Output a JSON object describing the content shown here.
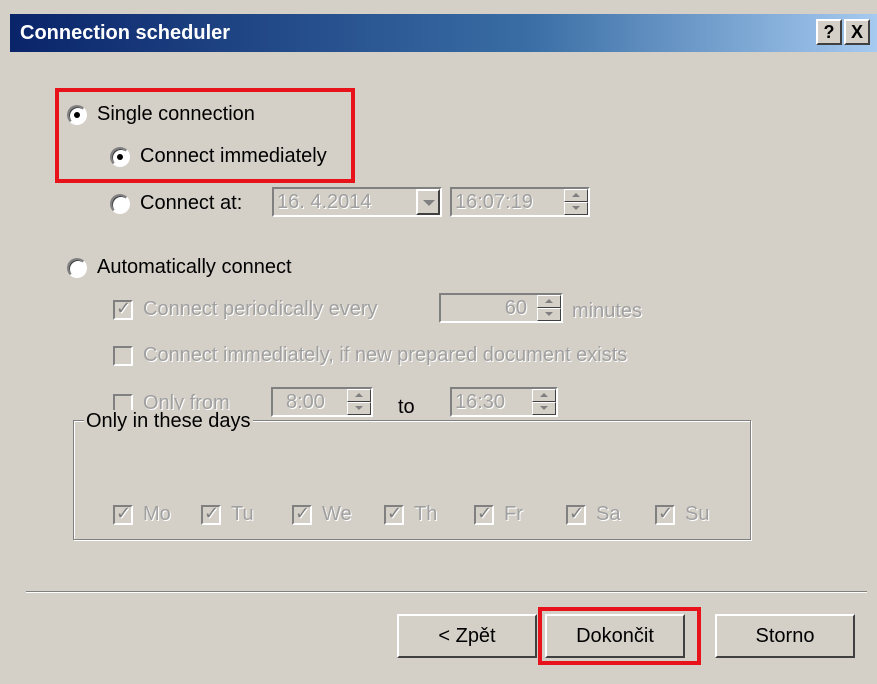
{
  "window": {
    "title": "Connection scheduler",
    "help_label": "?",
    "close_label": "X"
  },
  "single": {
    "label": "Single connection",
    "immediate_label": "Connect immediately",
    "at_label": "Connect at:",
    "date_value": "16.  4.2014",
    "time_value": "16:07:19"
  },
  "auto": {
    "label": "Automatically connect",
    "periodic_label": "Connect periodically every",
    "periodic_value": "60",
    "periodic_unit": "minutes",
    "new_doc_label": "Connect immediately, if new prepared document exists",
    "only_from_label": "Only from",
    "from_value": "8:00",
    "to_label": "to",
    "to_value": "16:30"
  },
  "days": {
    "legend": "Only in these days",
    "items": [
      "Mo",
      "Tu",
      "We",
      "Th",
      "Fr",
      "Sa",
      "Su"
    ]
  },
  "buttons": {
    "back": "< Zpět",
    "finish": "Dokončit",
    "cancel": "Storno"
  },
  "colors": {
    "highlight": "#e8121b",
    "title_bar": "#0a246a",
    "dialog_bg": "#d4d0c8"
  }
}
